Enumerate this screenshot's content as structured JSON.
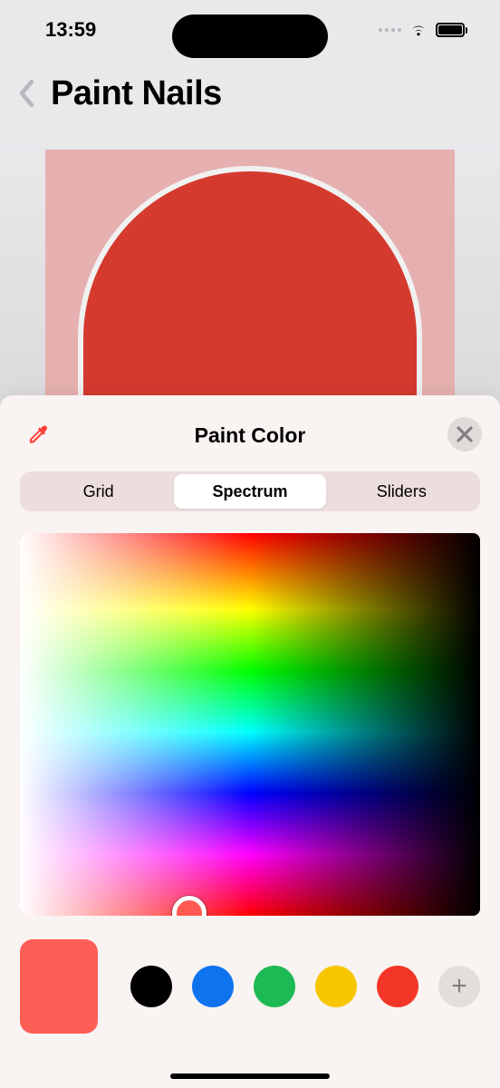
{
  "status": {
    "time": "13:59"
  },
  "nav": {
    "title": "Paint Nails"
  },
  "picker": {
    "title": "Paint Color",
    "tabs": {
      "grid": "Grid",
      "spectrum": "Spectrum",
      "sliders": "Sliders",
      "selected": "Spectrum"
    },
    "current_color": "#ff5e57",
    "spectrum_cursor_color": "#ff5a52",
    "presets": [
      {
        "name": "black",
        "color": "#000000"
      },
      {
        "name": "blue",
        "color": "#0f73ee"
      },
      {
        "name": "green",
        "color": "#1db954"
      },
      {
        "name": "yellow",
        "color": "#f7c600"
      },
      {
        "name": "red",
        "color": "#f33527"
      }
    ]
  }
}
